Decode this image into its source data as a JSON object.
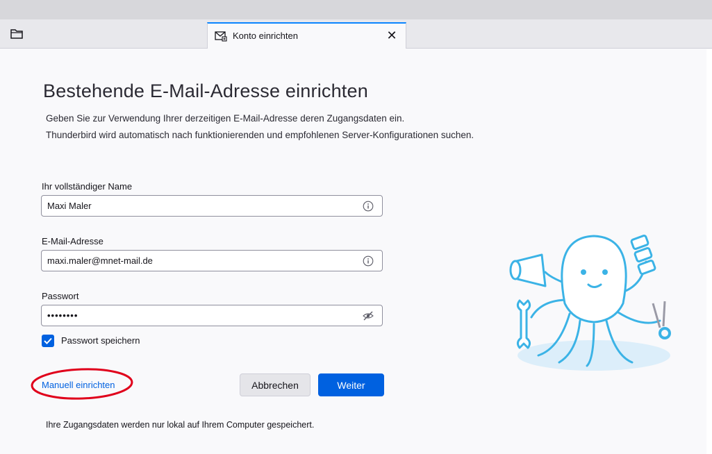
{
  "tab": {
    "title": "Konto einrichten",
    "close_glyph": "✕",
    "icon": "mail-setup-icon"
  },
  "page": {
    "heading": "Bestehende E-Mail-Adresse einrichten",
    "description_line1": "Geben Sie zur Verwendung Ihrer derzeitigen E-Mail-Adresse deren Zugangsdaten ein.",
    "description_line2": "Thunderbird wird automatisch nach funktionierenden und empfohlenen Server-Konfigurationen suchen."
  },
  "form": {
    "name_label": "Ihr vollständiger Name",
    "name_value": "Maxi Maler",
    "email_label": "E-Mail-Adresse",
    "email_value": "maxi.maler@mnet-mail.de",
    "password_label": "Passwort",
    "password_value": "••••••••",
    "remember_label": "Passwort speichern",
    "remember_checked": true
  },
  "actions": {
    "manual_label": "Manuell einrichten",
    "cancel_label": "Abbrechen",
    "next_label": "Weiter"
  },
  "footer": {
    "privacy_note": "Ihre Zugangsdaten werden nur lokal auf Ihrem Computer gespeichert."
  },
  "colors": {
    "accent": "#0061e0",
    "annotation": "#e0001b",
    "mascot": "#3bb3e6"
  }
}
